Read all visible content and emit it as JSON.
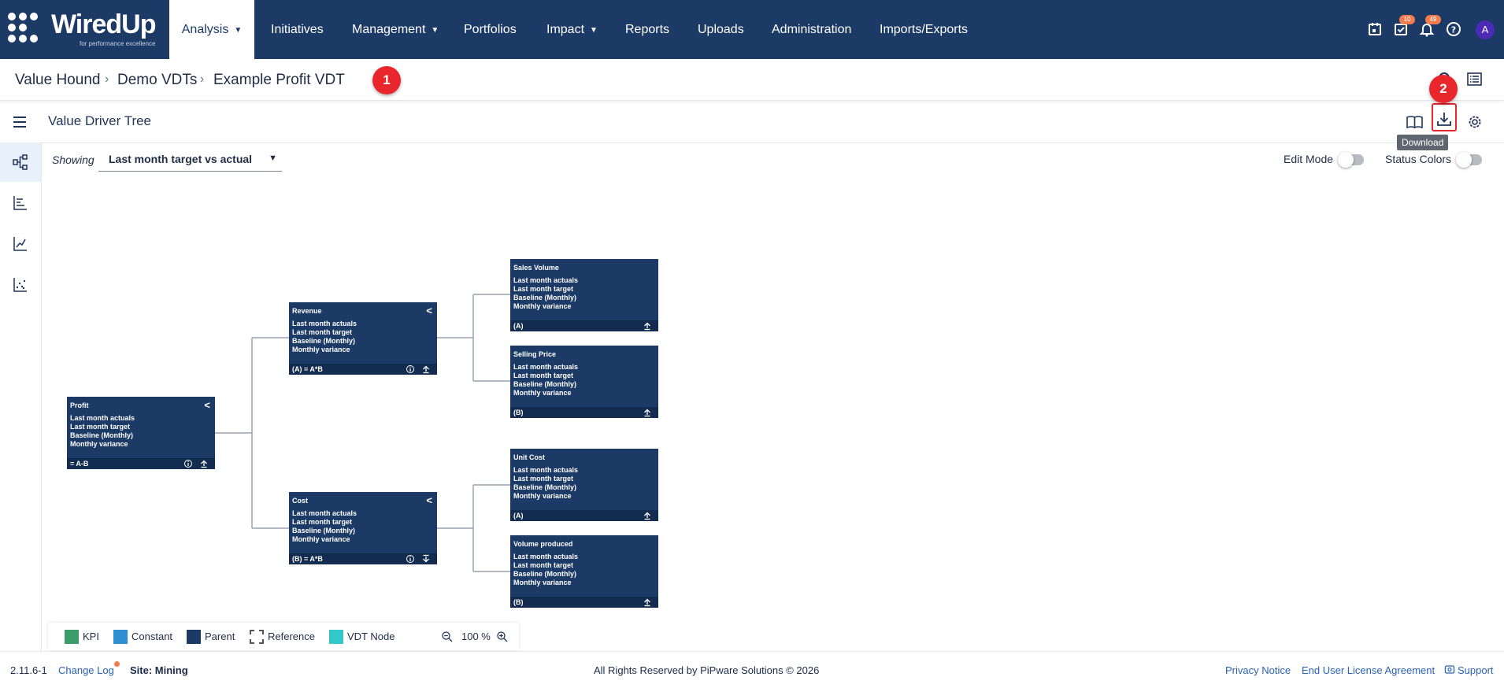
{
  "brand": {
    "name": "WiredUp",
    "tagline": "for performance excellence"
  },
  "nav": {
    "items": [
      {
        "label": "Analysis",
        "caret": true
      },
      {
        "label": "Initiatives",
        "caret": false
      },
      {
        "label": "Management",
        "caret": true
      },
      {
        "label": "Portfolios",
        "caret": false
      },
      {
        "label": "Impact",
        "caret": true
      },
      {
        "label": "Reports",
        "caret": false
      },
      {
        "label": "Uploads",
        "caret": false
      },
      {
        "label": "Administration",
        "caret": false
      },
      {
        "label": "Imports/Exports",
        "caret": false
      }
    ],
    "tasks_badge": "10",
    "notifications_badge": "49",
    "avatar_initial": "A"
  },
  "breadcrumb": [
    "Value Hound",
    "Demo VDTs",
    "Example Profit VDT"
  ],
  "markers": [
    "1",
    "2"
  ],
  "toolbar": {
    "title": "Value Driver Tree",
    "tooltip": "Download"
  },
  "controls": {
    "showing_label": "Showing",
    "showing_value": "Last month target vs actual",
    "edit_mode_label": "Edit Mode",
    "status_colors_label": "Status Colors"
  },
  "tree": {
    "nodes": [
      {
        "title": "Profit",
        "lines": [
          "Last month actuals",
          "Last month target",
          "Baseline (Monthly)",
          "Monthly variance"
        ],
        "footer": "= A-B"
      },
      {
        "title": "Revenue",
        "lines": [
          "Last month actuals",
          "Last month target",
          "Baseline (Monthly)",
          "Monthly variance"
        ],
        "footer": "(A) = A*B"
      },
      {
        "title": "Cost",
        "lines": [
          "Last month actuals",
          "Last month target",
          "Baseline (Monthly)",
          "Monthly variance"
        ],
        "footer": "(B) = A*B"
      },
      {
        "title": "Sales Volume",
        "lines": [
          "Last month actuals",
          "Last month target",
          "Baseline (Monthly)",
          "Monthly variance"
        ],
        "footer": "(A)"
      },
      {
        "title": "Selling Price",
        "lines": [
          "Last month actuals",
          "Last month target",
          "Baseline (Monthly)",
          "Monthly variance"
        ],
        "footer": "(B)"
      },
      {
        "title": "Unit Cost",
        "lines": [
          "Last month actuals",
          "Last month target",
          "Baseline (Monthly)",
          "Monthly variance"
        ],
        "footer": "(A)"
      },
      {
        "title": "Volume produced",
        "lines": [
          "Last month actuals",
          "Last month target",
          "Baseline (Monthly)",
          "Monthly variance"
        ],
        "footer": "(B)"
      }
    ]
  },
  "legend": {
    "items": [
      {
        "label": "KPI",
        "color": "#3a9d6b"
      },
      {
        "label": "Constant",
        "color": "#2f8fd1"
      },
      {
        "label": "Parent",
        "color": "#1c3a66"
      },
      {
        "label": "Reference",
        "color": "#ffffff"
      },
      {
        "label": "VDT Node",
        "color": "#33c7c7"
      }
    ],
    "zoom": "100 %"
  },
  "footer": {
    "version": "2.11.6-1",
    "changelog": "Change Log",
    "site": "Site: Mining",
    "copyright": "All Rights Reserved by PiPware Solutions © 2026",
    "privacy": "Privacy Notice",
    "eula": "End User License Agreement",
    "support": "Support"
  },
  "colors": {
    "nav_bg": "#1c3a66",
    "node_bg": "#1c3a66",
    "marker": "#e8262b",
    "link": "#2a62b5"
  }
}
